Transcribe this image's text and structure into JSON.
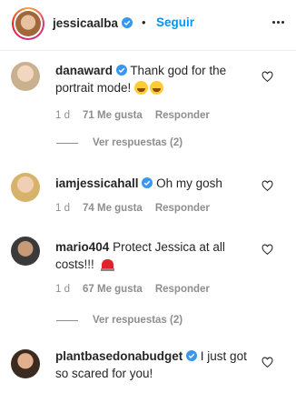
{
  "header": {
    "username": "jessicaalba",
    "separator": "•",
    "follow_label": "Seguir"
  },
  "icons": {
    "verified": "verified-badge-icon",
    "heart": "heart-outline-icon",
    "more": "more-options-icon"
  },
  "colors": {
    "link_blue": "#0095f6",
    "verified_blue": "#3897f0",
    "muted": "#8e8e8e"
  },
  "comments": [
    {
      "username": "danaward",
      "verified": true,
      "text": "Thank god for the portrait mode!",
      "emoji": "grinning-squinting-face x2",
      "age": "1 d",
      "likes": "71 Me gusta",
      "reply_label": "Responder",
      "view_replies": "Ver respuestas (2)"
    },
    {
      "username": "iamjessicahall",
      "verified": true,
      "text": "Oh my gosh",
      "age": "1 d",
      "likes": "74 Me gusta",
      "reply_label": "Responder"
    },
    {
      "username": "mario404",
      "verified": false,
      "text": "Protect Jessica at all costs!!!",
      "emoji": "police-light",
      "age": "1 d",
      "likes": "67 Me gusta",
      "reply_label": "Responder",
      "view_replies": "Ver respuestas (2)"
    },
    {
      "username": "plantbasedonabudget",
      "verified": true,
      "text": "I just got so scared for you!"
    }
  ]
}
